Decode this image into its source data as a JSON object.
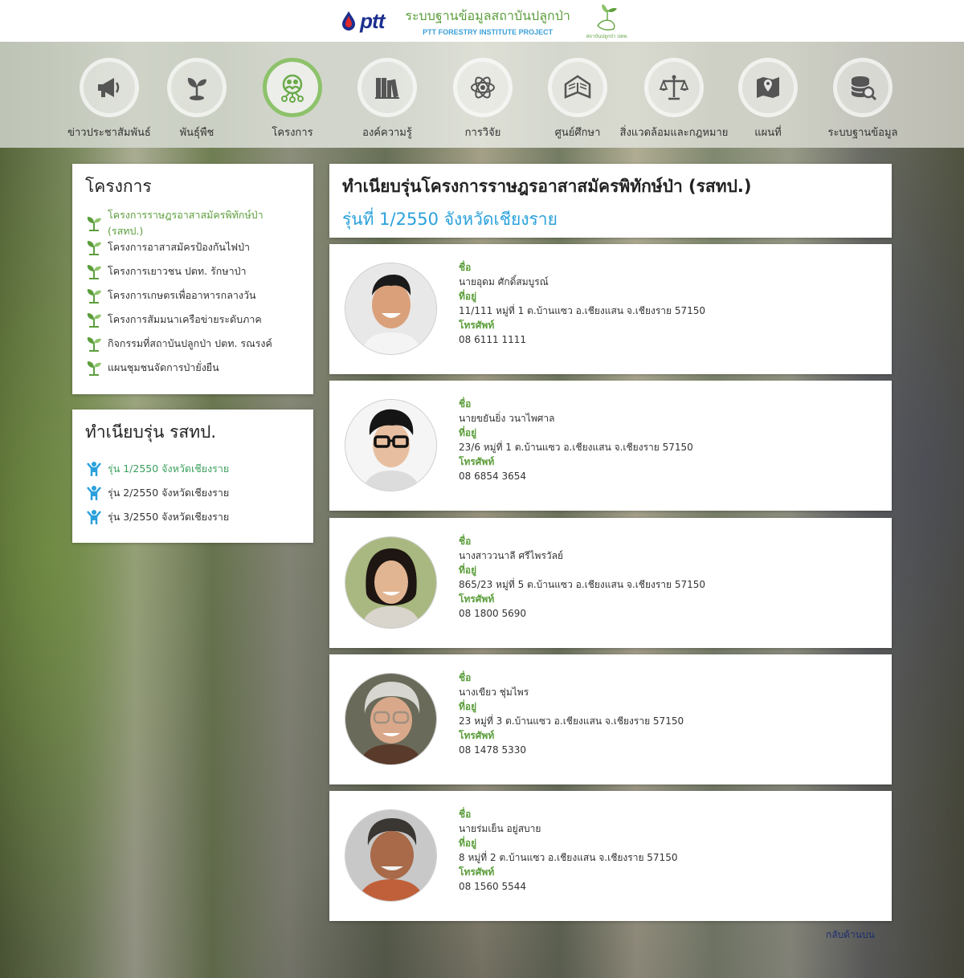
{
  "header": {
    "brand": "ptt",
    "title_th": "ระบบฐานข้อมูลสถาบันปลูกป่า",
    "title_en": "PTT FORESTRY INSTITUTE PROJECT",
    "logo_caption": "สถาบันปลูกป่า ปตท."
  },
  "nav": {
    "items": [
      {
        "label": "ข่าวประชาสัมพันธ์",
        "icon": "megaphone-icon"
      },
      {
        "label": "พันธุ์พืช",
        "icon": "sprout-icon"
      },
      {
        "label": "โครงการ",
        "icon": "people-network-icon",
        "active": true
      },
      {
        "label": "องค์ความรู้",
        "icon": "books-icon"
      },
      {
        "label": "การวิจัย",
        "icon": "atom-icon"
      },
      {
        "label": "ศูนย์ศึกษา",
        "icon": "open-book-icon"
      },
      {
        "label": "สิ่งแวดล้อมและกฎหมาย",
        "icon": "scales-icon"
      },
      {
        "label": "แผนที่",
        "icon": "map-icon"
      },
      {
        "label": "ระบบฐานข้อมูล",
        "icon": "database-search-icon"
      }
    ]
  },
  "sidebar": {
    "projects_title": "โครงการ",
    "projects": [
      {
        "label": "โครงการราษฎรอาสาสมัครพิทักษ์ป่า (รสทป.)",
        "active": true
      },
      {
        "label": "โครงการอาสาสมัครป้องกันไฟป่า"
      },
      {
        "label": "โครงการเยาวชน ปตท. รักษาป่า"
      },
      {
        "label": "โครงการเกษตรเพื่ออาหารกลางวัน"
      },
      {
        "label": "โครงการสัมมนาเครือข่ายระดับภาค"
      },
      {
        "label": "กิจกรรมที่สถาบันปลูกป่า ปตท. รณรงค์"
      },
      {
        "label": "แผนชุมชนจัดการป่ายั่งยืน"
      }
    ],
    "generations_title": "ทำเนียบรุ่น รสทป.",
    "generations": [
      {
        "label": "รุ่น 1/2550 จังหวัดเชียงราย",
        "active": true
      },
      {
        "label": "รุ่น 2/2550 จังหวัดเชียงราย"
      },
      {
        "label": "รุ่น 3/2550 จังหวัดเชียงราย"
      }
    ]
  },
  "main": {
    "title": "ทำเนียบรุ่นโครงการราษฎรอาสาสมัครพิทักษ์ป่า (รสทป.)",
    "subtitle": "รุ่นที่ 1/2550 จังหวัดเชียงราย",
    "labels": {
      "name": "ชื่อ",
      "address": "ที่อยู่",
      "phone": "โทรศัพท์"
    },
    "members": [
      {
        "name": "นายอุดม ศักดิ์สมบูรณ์",
        "address": "11/111 หมู่ที่ 1 ต.บ้านแซว อ.เชียงแสน จ.เชียงราย 57150",
        "phone": "08 6111 1111"
      },
      {
        "name": "นายขยันยิ่ง วนาไพศาล",
        "address": "23/6 หมู่ที่ 1 ต.บ้านแซว อ.เชียงแสน จ.เชียงราย 57150",
        "phone": "08 6854 3654"
      },
      {
        "name": "นางสาววนาลี ศรีไพรวัลย์",
        "address": "865/23 หมู่ที่ 5 ต.บ้านแซว อ.เชียงแสน จ.เชียงราย 57150",
        "phone": "08 1800 5690"
      },
      {
        "name": "นางเขียว ชุ่มไพร",
        "address": "23 หมู่ที่ 3 ต.บ้านแซว อ.เชียงแสน จ.เชียงราย 57150",
        "phone": "08 1478 5330"
      },
      {
        "name": "นายร่มเย็น อยู่สบาย",
        "address": "8 หมู่ที่ 2 ต.บ้านแซว อ.เชียงแสน จ.เชียงราย 57150",
        "phone": "08 1560 5544"
      }
    ]
  },
  "footer": {
    "back_to_top": "กลับด้านบน"
  },
  "colors": {
    "green": "#5c9e3c",
    "blue": "#2aa1dc",
    "active_ring": "#8dc26a"
  }
}
